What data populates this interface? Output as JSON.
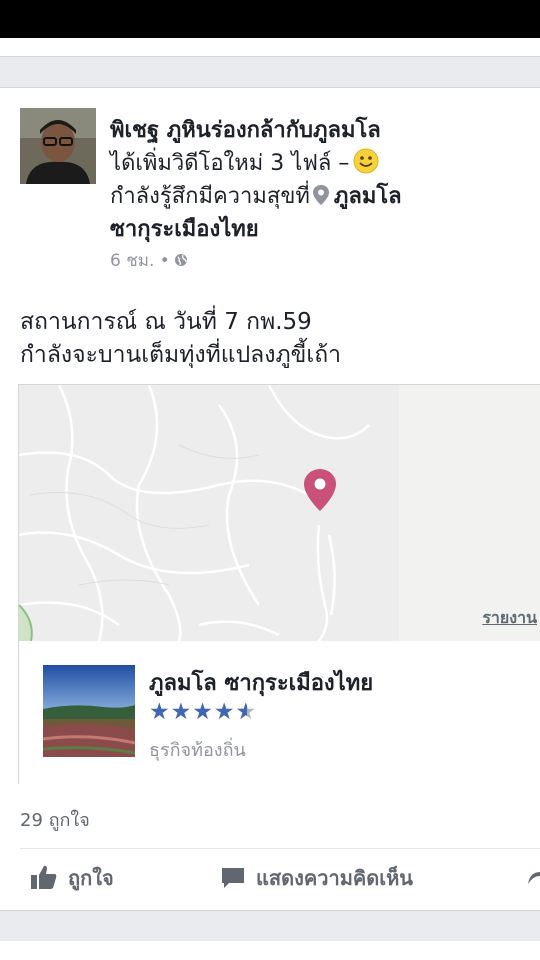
{
  "post": {
    "author": "พิเชฐ ภูหินร่องกล้ากับภูลมโล",
    "action_text": "ได้เพิ่มวิดีโอใหม่ 3 ไฟล์ –",
    "feeling_text": "กำลังรู้สึกมีความสุขที่",
    "location_part1": "ภูลมโล",
    "location_part2": "ซากุระเมืองไทย",
    "time": "6 ชม. •",
    "body_line1": "สถานการณ์ ณ วันที่ 7 กพ.59",
    "body_line2": "กำลังจะบานเต็มทุ่งที่แปลงภูขี้เถ้า"
  },
  "map": {
    "report_label": "รายงาน"
  },
  "place": {
    "name": "ภูลมโล ซากุระเมืองไทย",
    "rating": 4.5,
    "category": "ธุรกิจท้องถิ่น"
  },
  "footer": {
    "likes": "29 ถูกใจ",
    "like_label": "ถูกใจ",
    "comment_label": "แสดงความคิดเห็น"
  },
  "colors": {
    "accent": "#4267b2",
    "pin": "#c9517a",
    "muted": "#90949c"
  }
}
